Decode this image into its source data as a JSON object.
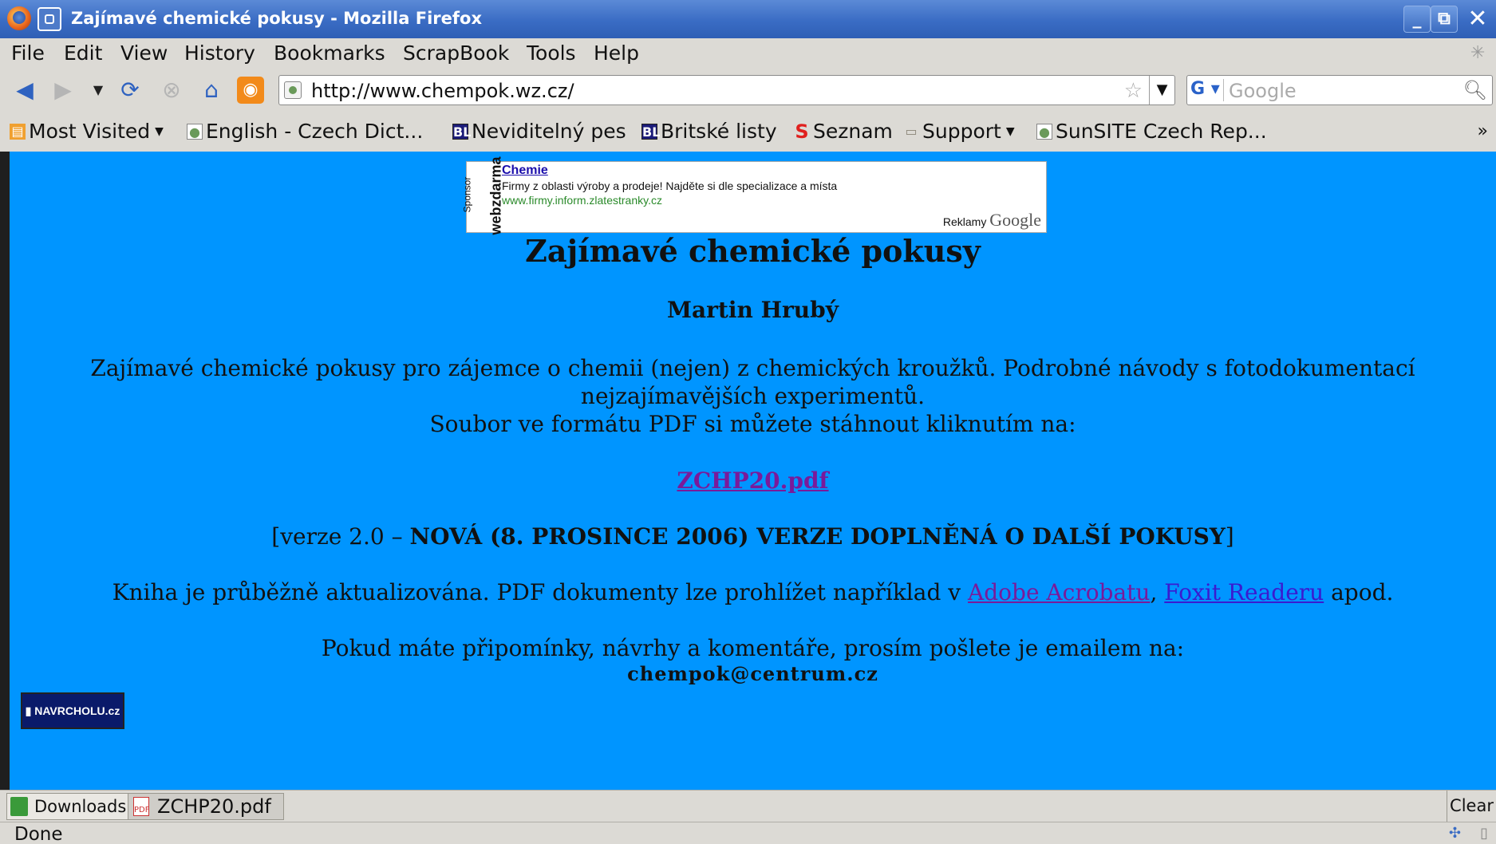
{
  "window": {
    "title": "Zajímavé chemické pokusy - Mozilla Firefox"
  },
  "menu": {
    "items": [
      "File",
      "Edit",
      "View",
      "History",
      "Bookmarks",
      "ScrapBook",
      "Tools",
      "Help"
    ]
  },
  "nav": {
    "url": "http://www.chempok.wz.cz/",
    "search_placeholder": "Google"
  },
  "bookmarks": {
    "items": [
      {
        "label": "Most Visited",
        "icon": "rss-folder-icon"
      },
      {
        "label": "English - Czech Dict...",
        "icon": "page-icon"
      },
      {
        "label": "Neviditelný pes",
        "icon": "bl-icon"
      },
      {
        "label": "Britské listy",
        "icon": "bl-icon"
      },
      {
        "label": "Seznam",
        "icon": "seznam-icon"
      },
      {
        "label": "Support",
        "icon": "folder-icon"
      },
      {
        "label": "SunSITE Czech Rep...",
        "icon": "page-icon"
      }
    ],
    "more": "»"
  },
  "ad": {
    "sponsor": "Sponsor",
    "webzdarma": "webzdarma",
    "title": "Chemie",
    "description": "Firmy z oblasti výroby a prodeje! Najděte si dle specializace a místa",
    "url": "www.firmy.inform.zlatestranky.cz",
    "reklamy": "Reklamy",
    "google": "Google"
  },
  "page": {
    "title": "Zajímavé chemické pokusy",
    "author": "Martin Hrubý",
    "intro_line1": "Zajímavé chemické pokusy pro zájemce o chemii (nejen) z chemických kroužků. Podrobné návody s fotodokumentací",
    "intro_line2": "nejzajímavějších experimentů.",
    "intro_line3": "Soubor ve formátu PDF si můžete stáhnout kliknutím na:",
    "pdf_link": "ZCHP20.pdf",
    "version_prefix": "[verze 2.0 – ",
    "version_bold": "NOVÁ (8. PROSINCE 2006) VERZE DOPLNĚNÁ O DALŠÍ POKUSY",
    "version_suffix": "]",
    "update_prefix": "Kniha je průběžně aktualizována. PDF dokumenty lze prohlížet například v ",
    "link_acrobat": "Adobe Acrobatu",
    "comma": ", ",
    "link_foxit": "Foxit Readeru",
    "update_suffix": " apod.",
    "contact": "Pokud máte připomínky, návrhy a komentáře, prosím pošlete je emailem na:",
    "email": "chempok@centrum.cz",
    "badge": "NAVRCHOLU.cz"
  },
  "downloads": {
    "label": "Downloads",
    "file": "ZCHP20.pdf",
    "clear": "Clear"
  },
  "status": {
    "text": "Done"
  }
}
